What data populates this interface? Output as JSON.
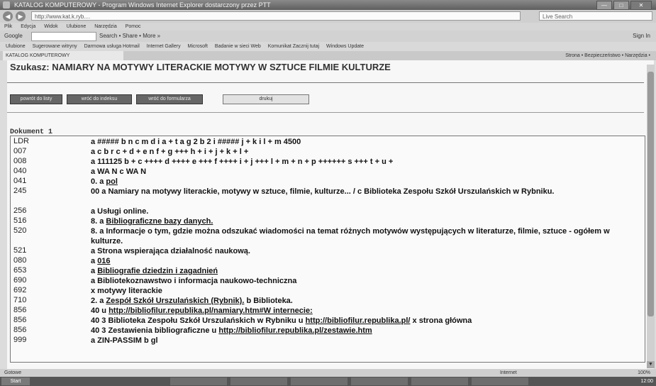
{
  "window": {
    "title": "KATALOG KOMPUTEROWY - Program Windows Internet Explorer dostarczony przez PTT",
    "buttons": [
      "—",
      "□",
      "✕"
    ]
  },
  "browser": {
    "address": "http://www.kat.k.ryb....",
    "search_placeholder": "Live Search",
    "menu": [
      "Plik",
      "Edycja",
      "Widok",
      "Ulubione",
      "Narzędzia",
      "Pomoc"
    ],
    "google_brand": "Google",
    "google_items": "Search • Share • More »",
    "google_right": "Sign In",
    "favorites": [
      "Ulubione",
      "Sugerowane witryny",
      "Darmowa usługa Hotmail",
      "Internet Gallery",
      "Microsoft",
      "Badanie w sieci Web",
      "Komunikat Zacznij tutaj",
      "Windows Update"
    ],
    "tab_title": "KATALOG KOMPUTEROWY",
    "tools": "Strona • Bezpieczeństwo • Narzędzia •"
  },
  "page": {
    "heading": "Szukasz: NAMIARY NA MOTYWY LITERACKIE MOTYWY W SZTUCE FILMIE KULTURZE",
    "buttons": [
      "powrót do listy",
      "wróć do indeksu",
      "wróć do formularza",
      "drukuj"
    ],
    "document_label": "Dokument 1"
  },
  "record": [
    {
      "tag": "LDR",
      "parts": [
        {
          "t": "a ##### b n c m d i a + t a g 2 b 2 i ##### j + k i l + m 4500",
          "s": "b"
        }
      ]
    },
    {
      "tag": "007",
      "parts": [
        {
          "t": "a c b r c + d + e n f + g +++ h + i + j + k + l +",
          "s": "b"
        }
      ]
    },
    {
      "tag": "008",
      "parts": [
        {
          "t": "a 111125 b + c ++++ d ++++ e +++ f ++++ i + j +++ l + m + n + p ++++++ s +++ t + u +",
          "s": "b"
        }
      ]
    },
    {
      "tag": "040",
      "parts": [
        {
          "t": "a WA N c WA N",
          "s": "b"
        }
      ]
    },
    {
      "tag": "041",
      "parts": [
        {
          "t": "0. a ",
          "s": "b"
        },
        {
          "t": "pol",
          "s": "u"
        }
      ]
    },
    {
      "tag": "245",
      "parts": [
        {
          "t": "00 a Namiary na motywy literackie, motywy w sztuce, filmie, kulturze... / c Biblioteka Zespołu Szkół Urszulańskich w Rybniku.",
          "s": "b"
        }
      ]
    },
    {
      "tag": "256",
      "parts": [
        {
          "t": "a Usługi online.",
          "s": "b"
        }
      ]
    },
    {
      "tag": "516",
      "parts": [
        {
          "t": "8. a ",
          "s": "b"
        },
        {
          "t": "Bibliograficzne bazy danych.",
          "s": "u"
        }
      ]
    },
    {
      "tag": "520",
      "parts": [
        {
          "t": "8. a Informacje o tym, gdzie można odszukać wiadomości na temat różnych motywów występujących w literaturze, filmie, sztuce - ogółem w kulturze.",
          "s": "b"
        }
      ]
    },
    {
      "tag": "521",
      "parts": [
        {
          "t": "a Strona wspierająca działalność naukową.",
          "s": "b"
        }
      ]
    },
    {
      "tag": "080",
      "parts": [
        {
          "t": "a ",
          "s": "b"
        },
        {
          "t": "016",
          "s": "u"
        }
      ]
    },
    {
      "tag": "653",
      "parts": [
        {
          "t": "a ",
          "s": "b"
        },
        {
          "t": "Bibliografie dziedzin i zagadnień",
          "s": "u"
        }
      ]
    },
    {
      "tag": "690",
      "parts": [
        {
          "t": "a Bibliotekoznawstwo i informacja naukowo-techniczna",
          "s": "b"
        }
      ]
    },
    {
      "tag": "692",
      "parts": [
        {
          "t": "x motywy literackie",
          "s": "b"
        }
      ]
    },
    {
      "tag": "710",
      "parts": [
        {
          "t": "2. a ",
          "s": "b"
        },
        {
          "t": "Zespół Szkół Urszulańskich (Rybnik).",
          "s": "u"
        },
        {
          "t": " b Biblioteka.",
          "s": "b"
        }
      ]
    },
    {
      "tag": "856",
      "parts": [
        {
          "t": "40 u ",
          "s": "b"
        },
        {
          "t": "http://bibliofilur.republika.pl/namiary.htm#W internecie:",
          "s": "u"
        }
      ]
    },
    {
      "tag": "856",
      "parts": [
        {
          "t": "40 3 Biblioteka Zespołu Szkół Urszulańskich w Rybniku u ",
          "s": "b"
        },
        {
          "t": "http://bibliofilur.republika.pl/",
          "s": "u"
        },
        {
          "t": " x strona główna",
          "s": "b"
        }
      ]
    },
    {
      "tag": "856",
      "parts": [
        {
          "t": "40 3 Zestawienia bibliograficzne u ",
          "s": "b"
        },
        {
          "t": "http://bibliofilur.republika.pl/zestawie.htm",
          "s": "u"
        }
      ]
    },
    {
      "tag": "999",
      "parts": [
        {
          "t": "a ZIN-PASSIM b gl",
          "s": "b"
        }
      ]
    }
  ],
  "status": {
    "left": "Gotowe",
    "mid": "Internet",
    "right": "100%"
  },
  "taskbar": {
    "start": "Start",
    "clock": "12:00"
  }
}
